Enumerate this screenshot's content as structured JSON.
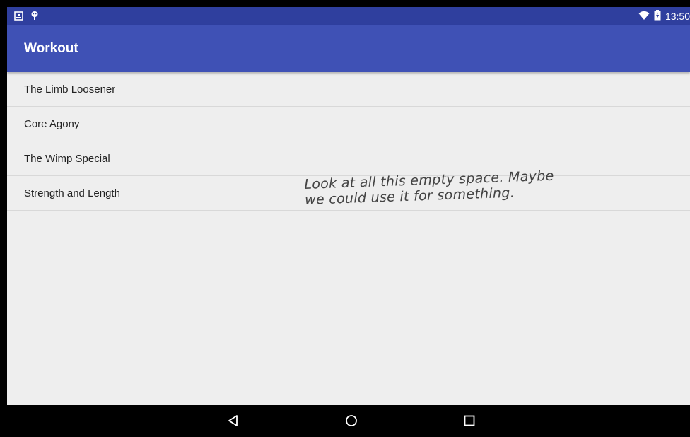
{
  "status_bar": {
    "time": "13:50",
    "left_icons": [
      "download-notification-icon",
      "android-debug-icon"
    ],
    "right_icons": [
      "wifi-icon",
      "battery-charging-icon"
    ]
  },
  "app_bar": {
    "title": "Workout"
  },
  "workout_list": {
    "items": [
      {
        "label": "The Limb Loosener"
      },
      {
        "label": "Core Agony"
      },
      {
        "label": "The Wimp Special"
      },
      {
        "label": "Strength and Length"
      }
    ]
  },
  "annotation": {
    "line1": "Look at all this empty space. Maybe",
    "line2": "we could use it for something."
  },
  "nav_bar": {
    "buttons": [
      "back-icon",
      "home-icon",
      "recents-icon"
    ]
  },
  "colors": {
    "primary": "#3f51b5",
    "primary_dark": "#2f3f9e",
    "background": "#eeeeee",
    "nav_bar": "#000000"
  }
}
